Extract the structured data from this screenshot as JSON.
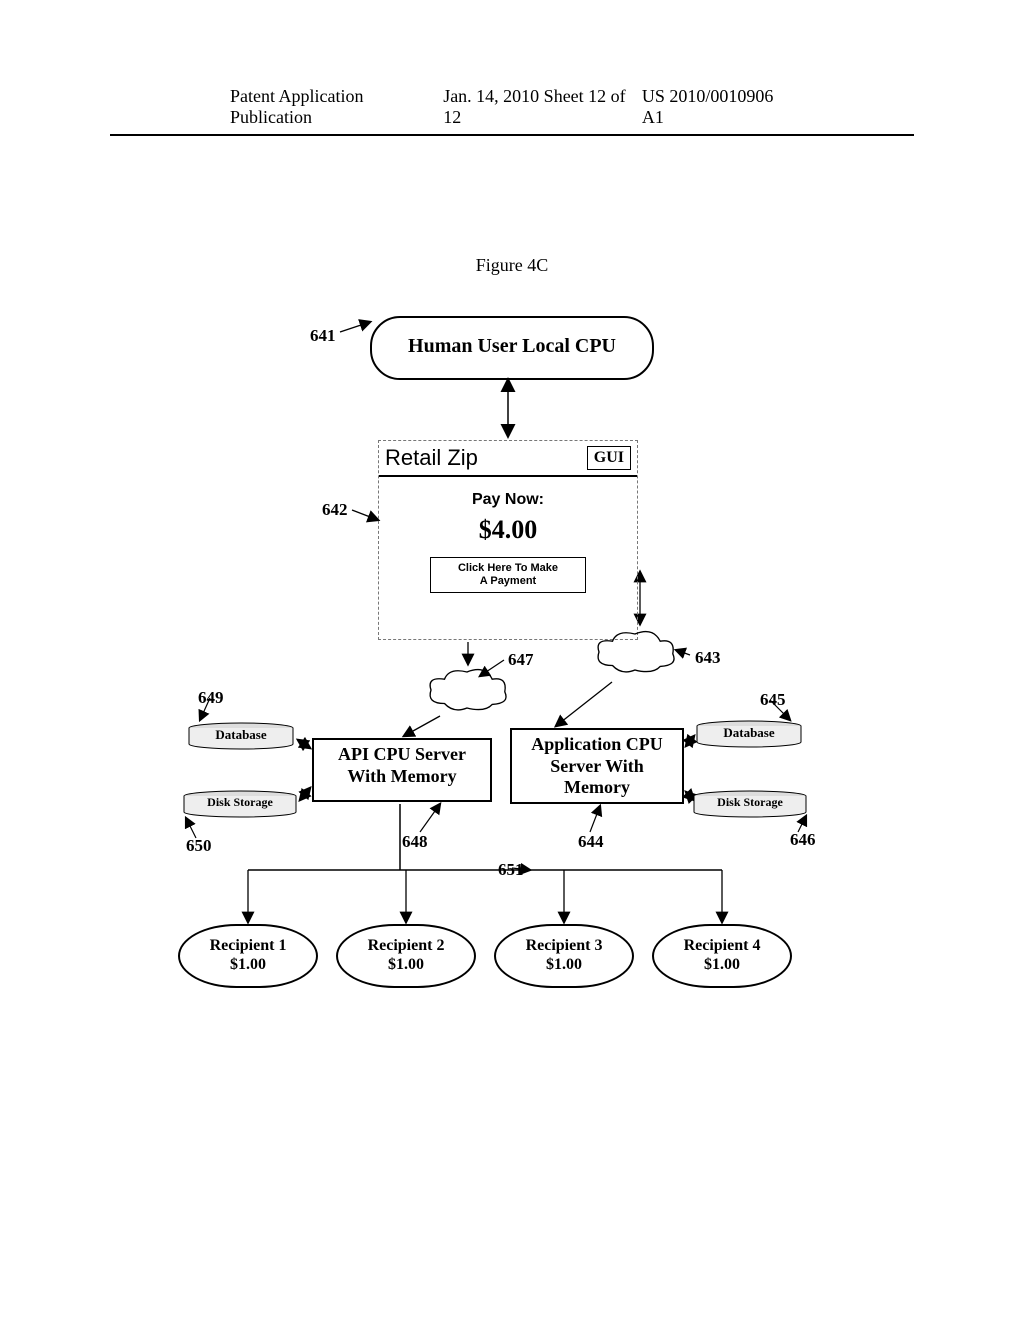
{
  "header": {
    "left": "Patent Application Publication",
    "mid": "Jan. 14, 2010  Sheet 12 of 12",
    "right": "US 2010/0010906 A1"
  },
  "figure_title": "Figure 4C",
  "nodes": {
    "n641": {
      "ref": "641",
      "label": "Human User Local CPU"
    },
    "n642": {
      "ref": "642",
      "title_left": "Retail Zip",
      "title_right": "GUI",
      "pay_label": "Pay Now:",
      "pay_amount": "$4.00",
      "pay_button_l1": "Click Here To Make",
      "pay_button_l2": "A Payment"
    },
    "n643": {
      "ref": "643",
      "kind": "cloud"
    },
    "n647": {
      "ref": "647",
      "kind": "cloud"
    },
    "n648": {
      "ref": "648",
      "label_l1": "API CPU Server",
      "label_l2": "With Memory"
    },
    "n644": {
      "ref": "644",
      "label_l1": "Application CPU",
      "label_l2": "Server With",
      "label_l3": "Memory"
    },
    "n649": {
      "ref": "649",
      "label": "Database"
    },
    "n645": {
      "ref": "645",
      "label": "Database"
    },
    "n650": {
      "ref": "650",
      "label": "Disk Storage"
    },
    "n646": {
      "ref": "646",
      "label": "Disk Storage"
    },
    "n651": {
      "ref": "651"
    }
  },
  "recipients": [
    {
      "name": "Recipient 1",
      "amount": "$1.00"
    },
    {
      "name": "Recipient 2",
      "amount": "$1.00"
    },
    {
      "name": "Recipient 3",
      "amount": "$1.00"
    },
    {
      "name": "Recipient 4",
      "amount": "$1.00"
    }
  ]
}
